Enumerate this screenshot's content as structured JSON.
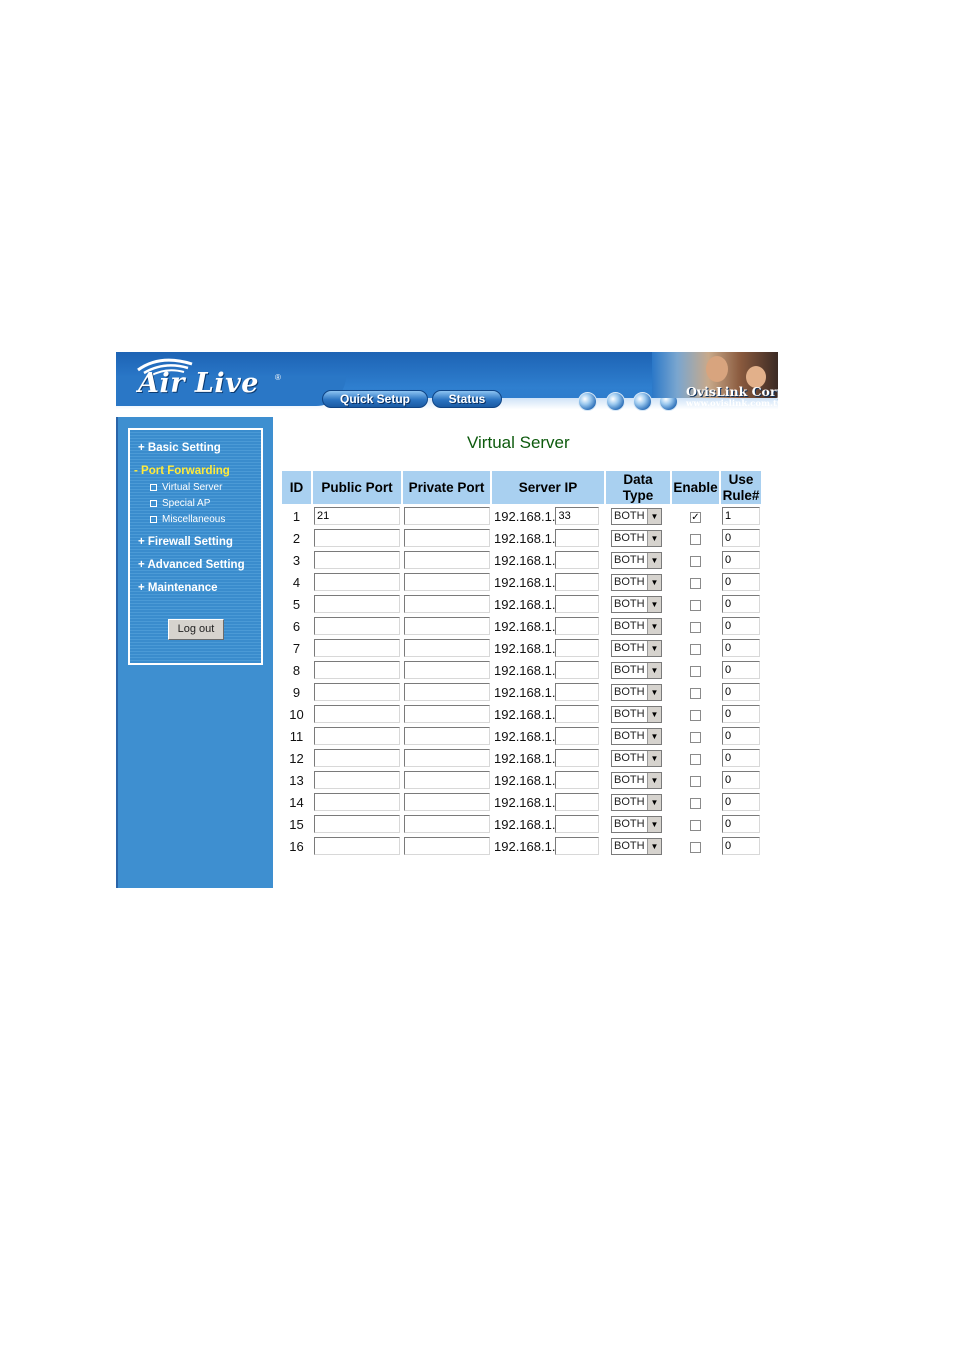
{
  "header": {
    "logo": "Air Live",
    "nav": {
      "quick_setup": "Quick Setup",
      "status": "Status"
    },
    "brand_name": "OvisLink Corp",
    "brand_url": "www.ovislink.com.tw",
    "colors": {
      "header_blue": "#2b78c8",
      "sidebar_blue": "#3e8fd0",
      "title_green": "#0d5a0d",
      "table_header": "#a9d0f0"
    }
  },
  "sidebar": {
    "items": [
      {
        "label": "+ Basic Setting"
      },
      {
        "label": "- Port Forwarding",
        "active": true
      },
      {
        "label": "+ Firewall Setting"
      },
      {
        "label": "+ Advanced Setting"
      },
      {
        "label": "+ Maintenance"
      }
    ],
    "sub_items": [
      {
        "label": "Virtual Server"
      },
      {
        "label": "Special AP"
      },
      {
        "label": "Miscellaneous"
      }
    ],
    "logout_label": "Log out"
  },
  "main": {
    "title": "Virtual Server",
    "columns": {
      "id": "ID",
      "public_port": "Public Port",
      "private_port": "Private Port",
      "server_ip": "Server IP",
      "data_type_1": "Data",
      "data_type_2": "Type",
      "enable": "Enable",
      "use_rule_1": "Use",
      "use_rule_2": "Rule#"
    },
    "ip_prefix": "192.168.1.",
    "rows": [
      {
        "id": "1",
        "public_port": "21",
        "private_port": "",
        "ip_suffix": "33",
        "data_type": "BOTH",
        "enabled": true,
        "rule": "1"
      },
      {
        "id": "2",
        "public_port": "",
        "private_port": "",
        "ip_suffix": "",
        "data_type": "BOTH",
        "enabled": false,
        "rule": "0"
      },
      {
        "id": "3",
        "public_port": "",
        "private_port": "",
        "ip_suffix": "",
        "data_type": "BOTH",
        "enabled": false,
        "rule": "0"
      },
      {
        "id": "4",
        "public_port": "",
        "private_port": "",
        "ip_suffix": "",
        "data_type": "BOTH",
        "enabled": false,
        "rule": "0"
      },
      {
        "id": "5",
        "public_port": "",
        "private_port": "",
        "ip_suffix": "",
        "data_type": "BOTH",
        "enabled": false,
        "rule": "0"
      },
      {
        "id": "6",
        "public_port": "",
        "private_port": "",
        "ip_suffix": "",
        "data_type": "BOTH",
        "enabled": false,
        "rule": "0"
      },
      {
        "id": "7",
        "public_port": "",
        "private_port": "",
        "ip_suffix": "",
        "data_type": "BOTH",
        "enabled": false,
        "rule": "0"
      },
      {
        "id": "8",
        "public_port": "",
        "private_port": "",
        "ip_suffix": "",
        "data_type": "BOTH",
        "enabled": false,
        "rule": "0"
      },
      {
        "id": "9",
        "public_port": "",
        "private_port": "",
        "ip_suffix": "",
        "data_type": "BOTH",
        "enabled": false,
        "rule": "0"
      },
      {
        "id": "10",
        "public_port": "",
        "private_port": "",
        "ip_suffix": "",
        "data_type": "BOTH",
        "enabled": false,
        "rule": "0"
      },
      {
        "id": "11",
        "public_port": "",
        "private_port": "",
        "ip_suffix": "",
        "data_type": "BOTH",
        "enabled": false,
        "rule": "0"
      },
      {
        "id": "12",
        "public_port": "",
        "private_port": "",
        "ip_suffix": "",
        "data_type": "BOTH",
        "enabled": false,
        "rule": "0"
      },
      {
        "id": "13",
        "public_port": "",
        "private_port": "",
        "ip_suffix": "",
        "data_type": "BOTH",
        "enabled": false,
        "rule": "0"
      },
      {
        "id": "14",
        "public_port": "",
        "private_port": "",
        "ip_suffix": "",
        "data_type": "BOTH",
        "enabled": false,
        "rule": "0"
      },
      {
        "id": "15",
        "public_port": "",
        "private_port": "",
        "ip_suffix": "",
        "data_type": "BOTH",
        "enabled": false,
        "rule": "0"
      },
      {
        "id": "16",
        "public_port": "",
        "private_port": "",
        "ip_suffix": "",
        "data_type": "BOTH",
        "enabled": false,
        "rule": "0"
      }
    ]
  }
}
